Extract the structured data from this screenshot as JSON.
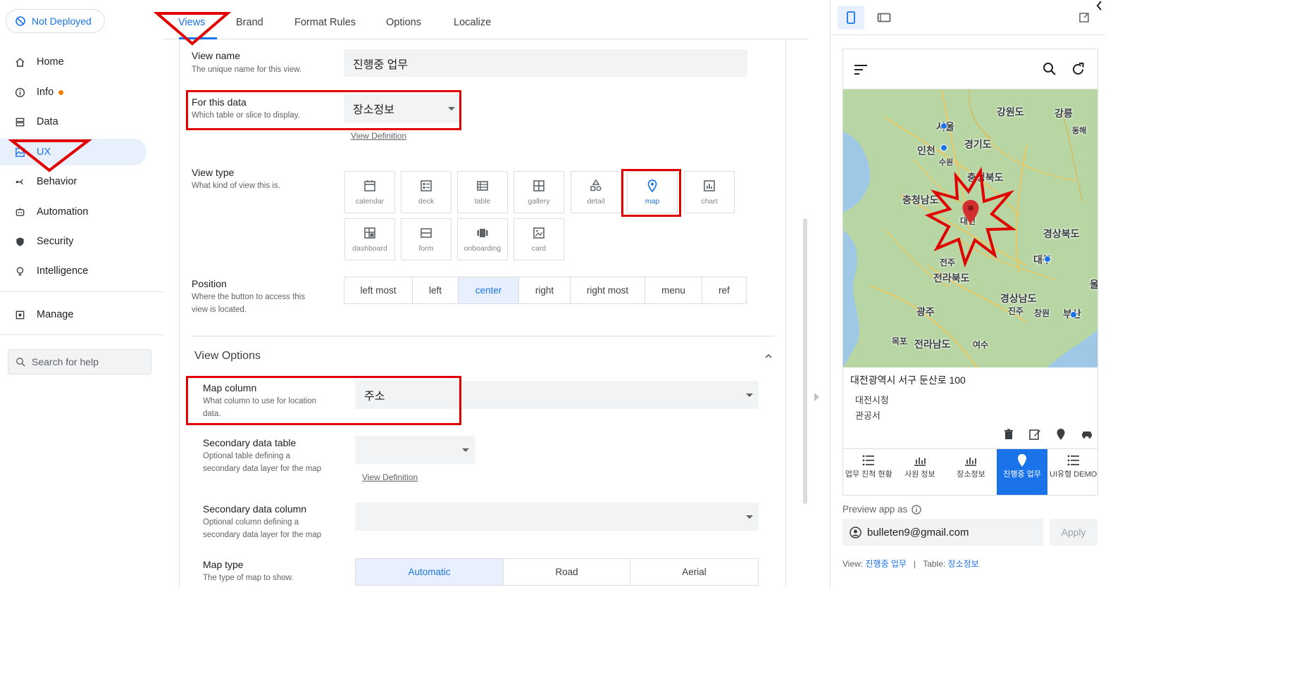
{
  "deploy_status": "Not Deployed",
  "sidebar": {
    "items": [
      {
        "label": "Home",
        "icon": "home-icon"
      },
      {
        "label": "Info",
        "icon": "info-icon"
      },
      {
        "label": "Data",
        "icon": "data-icon"
      },
      {
        "label": "UX",
        "icon": "ux-icon"
      },
      {
        "label": "Behavior",
        "icon": "behavior-icon"
      },
      {
        "label": "Automation",
        "icon": "automation-icon"
      },
      {
        "label": "Security",
        "icon": "shield-icon"
      },
      {
        "label": "Intelligence",
        "icon": "lightbulb-icon"
      },
      {
        "label": "Manage",
        "icon": "manage-icon"
      }
    ],
    "help_placeholder": "Search for help"
  },
  "tabs": [
    "Views",
    "Brand",
    "Format Rules",
    "Options",
    "Localize"
  ],
  "form": {
    "view_name": {
      "label": "View name",
      "desc": "The unique name for this view.",
      "value": "진행중 업무"
    },
    "for_this_data": {
      "label": "For this data",
      "desc": "Which table or slice to display.",
      "value": "장소정보",
      "link": "View Definition"
    },
    "view_type": {
      "label": "View type",
      "desc": "What kind of view this is.",
      "options": [
        "calendar",
        "deck",
        "table",
        "gallery",
        "detail",
        "map",
        "chart",
        "dashboard",
        "form",
        "onboarding",
        "card"
      ],
      "selected": "map"
    },
    "position": {
      "label": "Position",
      "desc_line1": "Where the button to access this",
      "desc_line2": "view is located.",
      "options": [
        "left most",
        "left",
        "center",
        "right",
        "right most",
        "menu",
        "ref"
      ],
      "selected": "center"
    },
    "view_options_title": "View Options",
    "map_column": {
      "label": "Map column",
      "desc_line1": "What column to use for location",
      "desc_line2": "data.",
      "value": "주소"
    },
    "secondary_table": {
      "label": "Secondary data table",
      "desc_line1": "Optional table defining a",
      "desc_line2": "secondary data layer for the map",
      "value": "",
      "link": "View Definition"
    },
    "secondary_column": {
      "label": "Secondary data column",
      "desc_line1": "Optional column defining a",
      "desc_line2": "secondary data layer for the map",
      "value": ""
    },
    "map_type": {
      "label": "Map type",
      "desc": "The type of map to show.",
      "options": [
        "Automatic",
        "Road",
        "Aerial"
      ],
      "selected": "Automatic"
    }
  },
  "preview": {
    "map_labels": [
      "강원도",
      "강릉",
      "동해",
      "서울",
      "인천",
      "경기도",
      "수원",
      "충청북도",
      "충청남도",
      "대전",
      "경상북도",
      "대구",
      "전주",
      "전라북도",
      "울",
      "경상남도",
      "진주",
      "창원",
      "부산",
      "광주",
      "목포",
      "전라남도",
      "여수"
    ],
    "card": {
      "address": "대전광역시 서구 둔산로 100",
      "line1": "대전시청",
      "line2": "관공서"
    },
    "bottom_nav": [
      {
        "label": "업무 진척 현황",
        "icon": "list-icon"
      },
      {
        "label": "사원 정보",
        "icon": "bar-chart-icon"
      },
      {
        "label": "장소정보",
        "icon": "bar-chart-icon"
      },
      {
        "label": "진행중 업무",
        "icon": "map-pin-icon"
      },
      {
        "label": "UI유형 DEMO",
        "icon": "list-icon"
      }
    ],
    "active_nav": "진행중 업무",
    "preview_as_label": "Preview app as",
    "email": "bulleten9@gmail.com",
    "apply_label": "Apply",
    "footer": {
      "view_label": "View:",
      "view_value": "진행중 업무",
      "sep": "|",
      "table_label": "Table:",
      "table_value": "장소정보"
    }
  },
  "colors": {
    "accent": "#1a73e8",
    "annotation": "#e00000",
    "info_dot": "#f57c00"
  }
}
